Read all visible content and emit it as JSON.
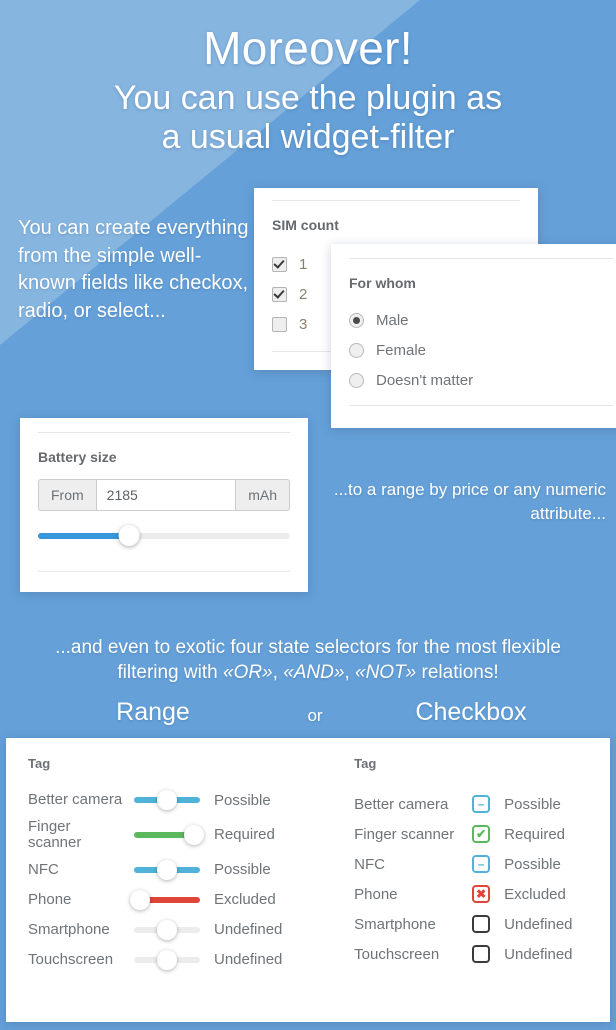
{
  "colors": {
    "bg_light": "#86b5e0",
    "bg_dark": "#65a0d8",
    "accent_blue": "#3498db",
    "possible_cyan": "#4fb3d9",
    "required_green": "#5cb85c",
    "excluded_red": "#e0453a",
    "undefined_grey": "#ececec"
  },
  "headline": {
    "line1": "Moreover!",
    "line2": "You can use the plugin as",
    "line3": "a usual widget-filter"
  },
  "left_note": "You can create everything from the simple well-known fields like checkox, radio, or select...",
  "right_note": "...to a range by price or any numeric attribute...",
  "sim_card": {
    "title": "SIM count",
    "options": [
      {
        "label": "1",
        "checked": true
      },
      {
        "label": "2",
        "checked": true
      },
      {
        "label": "3",
        "checked": false
      }
    ]
  },
  "whom_card": {
    "title": "For whom",
    "options": [
      {
        "label": "Male",
        "selected": true
      },
      {
        "label": "Female",
        "selected": false
      },
      {
        "label": "Doesn't matter",
        "selected": false
      }
    ]
  },
  "battery_card": {
    "title": "Battery size",
    "prefix_label": "From",
    "value": "2185",
    "placeholder": "2185",
    "suffix_label": "mAh",
    "slider_percent": 36
  },
  "exotic": {
    "line1": "...and even to exotic four state selectors for the most flexible",
    "line2_a": "filtering with ",
    "line2_or": "«OR»",
    "line2_sep1": ", ",
    "line2_and": "«AND»",
    "line2_sep2": ", ",
    "line2_not": "«NOT»",
    "line2_b": " relations!",
    "label_range": "Range",
    "label_or": "or",
    "label_checkbox": "Checkbox"
  },
  "range_panel": {
    "title": "Tag",
    "rows": [
      {
        "name": "Better camera",
        "state": "Possible",
        "color": "#4fb3d9",
        "knob_percent": 50
      },
      {
        "name": "Finger scanner",
        "state": "Required",
        "color": "#5cb85c",
        "knob_percent": 100
      },
      {
        "name": "NFC",
        "state": "Possible",
        "color": "#4fb3d9",
        "knob_percent": 50
      },
      {
        "name": "Phone",
        "state": "Excluded",
        "color": "#e0453a",
        "knob_percent": 0
      },
      {
        "name": "Smartphone",
        "state": "Undefined",
        "color": "#ececec",
        "knob_percent": 50
      },
      {
        "name": "Touchscreen",
        "state": "Undefined",
        "color": "#ececec",
        "knob_percent": 50
      }
    ]
  },
  "checkbox_panel": {
    "title": "Tag",
    "rows": [
      {
        "name": "Better camera",
        "state": "Possible",
        "glyph": "minus-icon",
        "symbol": "–",
        "color": "#4fb3d9"
      },
      {
        "name": "Finger scanner",
        "state": "Required",
        "glyph": "check-icon",
        "symbol": "✔",
        "color": "#5cb85c"
      },
      {
        "name": "NFC",
        "state": "Possible",
        "glyph": "minus-icon",
        "symbol": "–",
        "color": "#4fb3d9"
      },
      {
        "name": "Phone",
        "state": "Excluded",
        "glyph": "cross-icon",
        "symbol": "✖",
        "color": "#e0453a"
      },
      {
        "name": "Smartphone",
        "state": "Undefined",
        "glyph": "empty-icon",
        "symbol": "",
        "color": "#3b3b3b"
      },
      {
        "name": "Touchscreen",
        "state": "Undefined",
        "glyph": "empty-icon",
        "symbol": "",
        "color": "#3b3b3b"
      }
    ]
  }
}
